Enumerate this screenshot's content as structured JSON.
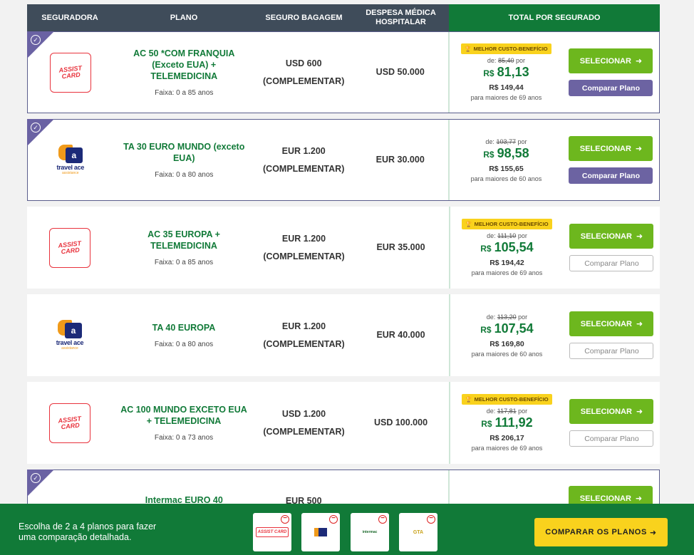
{
  "header": {
    "col_insurer": "SEGURADORA",
    "col_plan": "PLANO",
    "col_baggage": "SEGURO BAGAGEM",
    "col_medical": "DESPESA MÉDICA HOSPITALAR",
    "col_total": "TOTAL POR SEGURADO"
  },
  "labels": {
    "best_value": "MELHOR CUSTO-BENEFÍCIO",
    "from": "de:",
    "per": "por",
    "currency": "R$",
    "select": "SELECIONAR",
    "compare_plan": "Comparar Plano",
    "complementary": "(COMPLEMENTAR)"
  },
  "plans": [
    {
      "logo": "ASSIST CARD",
      "name": "AC 50 *COM FRANQUIA (Exceto EUA) + TELEMEDICINA",
      "range": "Faixa: 0 a 85 anos",
      "baggage": "USD 600",
      "medical": "USD 50.000",
      "old_price": "85,40",
      "price": "81,13",
      "senior_price": "R$ 149,44",
      "senior_note": "para maiores de 69 anos"
    },
    {
      "logo": "travel ace",
      "name": "TA 30 EURO MUNDO (exceto EUA)",
      "range": "Faixa: 0 a 80 anos",
      "baggage": "EUR 1.200",
      "medical": "EUR 30.000",
      "old_price": "103,77",
      "price": "98,58",
      "senior_price": "R$ 155,65",
      "senior_note": "para maiores de 60 anos"
    },
    {
      "logo": "ASSIST CARD",
      "name": "AC 35 EUROPA + TELEMEDICINA",
      "range": "Faixa: 0 a 85 anos",
      "baggage": "EUR 1.200",
      "medical": "EUR 35.000",
      "old_price": "111,10",
      "price": "105,54",
      "senior_price": "R$ 194,42",
      "senior_note": "para maiores de 69 anos"
    },
    {
      "logo": "travel ace",
      "name": "TA 40 EUROPA",
      "range": "Faixa: 0 a 80 anos",
      "baggage": "EUR 1.200",
      "medical": "EUR 40.000",
      "old_price": "113,20",
      "price": "107,54",
      "senior_price": "R$ 169,80",
      "senior_note": "para maiores de 60 anos"
    },
    {
      "logo": "ASSIST CARD",
      "name": "AC 100 MUNDO EXCETO EUA + TELEMEDICINA",
      "range": "Faixa: 0 a 73 anos",
      "baggage": "USD 1.200",
      "medical": "USD 100.000",
      "old_price": "117,81",
      "price": "111,92",
      "senior_price": "R$ 206,17",
      "senior_note": "para maiores de 69 anos"
    },
    {
      "logo": "Intermac",
      "name": "Intermac EURO 40",
      "baggage": "EUR 500"
    }
  ],
  "footer": {
    "text": "Escolha de 2 a 4 planos para fazer uma comparação detalhada.",
    "compare_button": "COMPARAR OS PLANOS",
    "thumbs": [
      "ASSIST CARD",
      "travel ace",
      "intermac",
      "GTA"
    ]
  },
  "logo_text": {
    "ac_line1": "ASSIST",
    "ac_line2": "CARD",
    "ta_name": "travel ace",
    "ta_sub": "assistance",
    "ta_mark": "a"
  },
  "colors": {
    "accent_green": "#117a38",
    "button_green": "#6db71e",
    "purple": "#6c63a2",
    "badge_yellow": "#f9d21d",
    "header_dark": "#3f4c5a"
  }
}
